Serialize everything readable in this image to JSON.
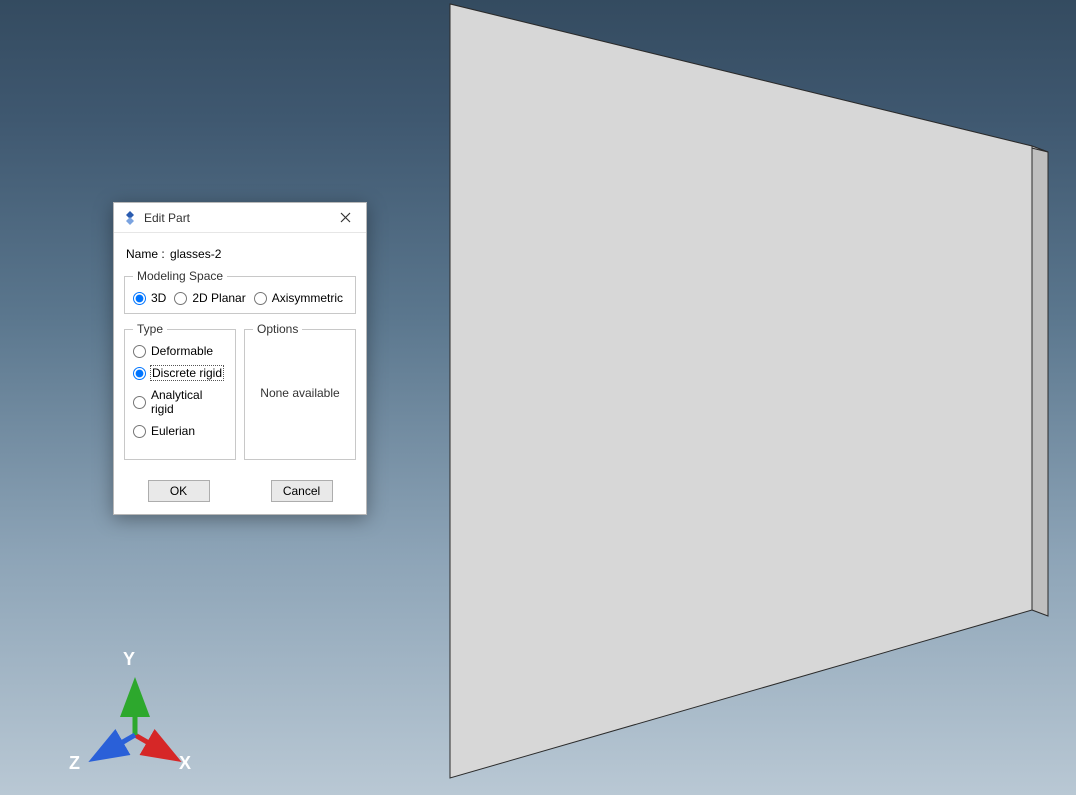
{
  "dialog": {
    "title": "Edit Part",
    "name_label": "Name :",
    "name_value": "glasses-2",
    "modeling_space": {
      "legend": "Modeling Space",
      "options": [
        "3D",
        "2D Planar",
        "Axisymmetric"
      ],
      "selected": "3D"
    },
    "type": {
      "legend": "Type",
      "options": [
        "Deformable",
        "Discrete rigid",
        "Analytical rigid",
        "Eulerian"
      ],
      "selected": "Discrete rigid"
    },
    "options_panel": {
      "legend": "Options",
      "text": "None available"
    },
    "buttons": {
      "ok": "OK",
      "cancel": "Cancel"
    }
  },
  "triad": {
    "x_label": "X",
    "y_label": "Y",
    "z_label": "Z",
    "colors": {
      "x": "#d62727",
      "y": "#2da82d",
      "z": "#2a60d8"
    }
  },
  "geometry": {
    "description": "Thin rectangular 3D plate in isometric view",
    "face_color": "#d6d6d6",
    "edge_color": "#2b2b2b"
  }
}
